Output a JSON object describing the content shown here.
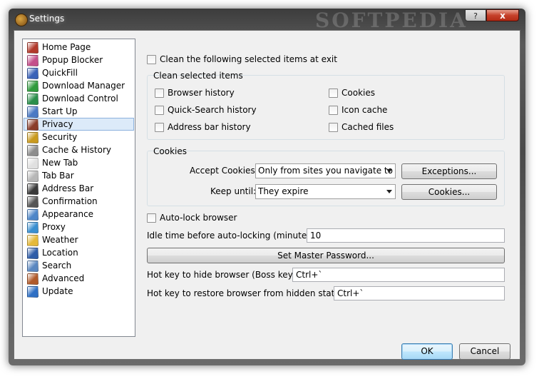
{
  "window": {
    "title": "Settings",
    "watermark": "SOFTPEDIA",
    "help_label": "?",
    "close_label": "x"
  },
  "sidebar": {
    "items": [
      {
        "label": "Home Page",
        "icon": "home-icon",
        "color": "#b23a2c"
      },
      {
        "label": "Popup Blocker",
        "icon": "popup-icon",
        "color": "#c44f8a"
      },
      {
        "label": "QuickFill",
        "icon": "quickfill-icon",
        "color": "#3a62b8"
      },
      {
        "label": "Download Manager",
        "icon": "download-manager-icon",
        "color": "#2f9a3c"
      },
      {
        "label": "Download Control",
        "icon": "download-control-icon",
        "color": "#2a8e4a"
      },
      {
        "label": "Start Up",
        "icon": "startup-icon",
        "color": "#4a79c4"
      },
      {
        "label": "Privacy",
        "icon": "privacy-icon",
        "color": "#8a3d2a"
      },
      {
        "label": "Security",
        "icon": "lock-icon",
        "color": "#c99a1f"
      },
      {
        "label": "Cache & History",
        "icon": "history-icon",
        "color": "#8d8d8d"
      },
      {
        "label": "New Tab",
        "icon": "new-tab-icon",
        "color": "#e0e0e0"
      },
      {
        "label": "Tab Bar",
        "icon": "tab-bar-icon",
        "color": "#b7b7b7"
      },
      {
        "label": "Address Bar",
        "icon": "address-bar-icon",
        "color": "#3a3a3a"
      },
      {
        "label": "Confirmation",
        "icon": "confirmation-icon",
        "color": "#555555"
      },
      {
        "label": "Appearance",
        "icon": "appearance-icon",
        "color": "#4d86c8"
      },
      {
        "label": "Proxy",
        "icon": "proxy-icon",
        "color": "#3a8fd0"
      },
      {
        "label": "Weather",
        "icon": "weather-icon",
        "color": "#e5b93a"
      },
      {
        "label": "Location",
        "icon": "location-icon",
        "color": "#2f5da8"
      },
      {
        "label": "Search",
        "icon": "search-icon",
        "color": "#5a87c0"
      },
      {
        "label": "Advanced",
        "icon": "tools-icon",
        "color": "#b05a2a"
      },
      {
        "label": "Update",
        "icon": "update-icon",
        "color": "#2e6fc4"
      }
    ],
    "selected_index": 6
  },
  "privacy": {
    "clean_on_exit_label": "Clean the following selected items at exit",
    "clean_group_title": "Clean selected items",
    "browser_history": "Browser history",
    "quick_search_history": "Quick-Search history",
    "address_bar_history": "Address bar history",
    "cookies": "Cookies",
    "icon_cache": "Icon cache",
    "cached_files": "Cached files",
    "cookies_group_title": "Cookies",
    "accept_cookies_label": "Accept Cookies:",
    "accept_cookies_value": "Only from sites you navigate to",
    "exceptions_button": "Exceptions...",
    "keep_until_label": "Keep until:",
    "keep_until_value": "They expire",
    "cookies_button": "Cookies...",
    "auto_lock_label": "Auto-lock browser",
    "idle_time_label": "Idle time before auto-locking (minutes):",
    "idle_time_value": "10",
    "master_password_button": "Set Master Password...",
    "hide_hotkey_label": "Hot key to hide browser (Boss key):",
    "hide_hotkey_value": "Ctrl+`",
    "restore_hotkey_label": "Hot key to restore browser from hidden state:",
    "restore_hotkey_value": "Ctrl+`"
  },
  "footer": {
    "ok_button": "OK",
    "cancel_button": "Cancel"
  }
}
